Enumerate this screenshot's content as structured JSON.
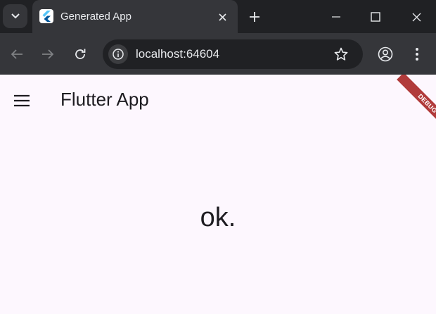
{
  "tab": {
    "title": "Generated App"
  },
  "address": {
    "url": "localhost:64604"
  },
  "app": {
    "title": "Flutter App",
    "body_text": "ok.",
    "debug_banner": "DEBUG"
  },
  "colors": {
    "chrome_dark": "#202124",
    "chrome_tab": "#35363a",
    "app_bg": "#fdf7fe",
    "debug_banner": "#b13b3b"
  },
  "icons": [
    "tab-search-icon",
    "flutter-icon",
    "close-icon",
    "plus-icon",
    "minimize-icon",
    "maximize-icon",
    "window-close-icon",
    "back-arrow-icon",
    "forward-arrow-icon",
    "reload-icon",
    "info-icon",
    "star-icon",
    "profile-icon",
    "more-vert-icon",
    "hamburger-menu-icon"
  ]
}
